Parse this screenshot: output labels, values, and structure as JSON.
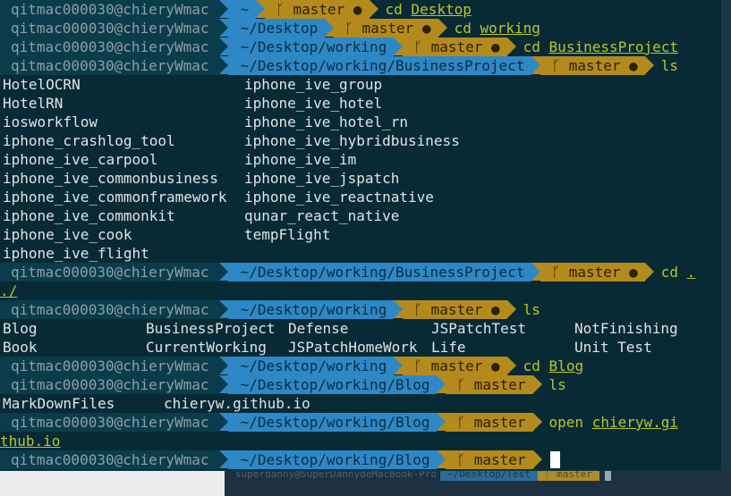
{
  "user": "qitmac000030@chieryWmac",
  "branch": "master",
  "background_window": {
    "prompt_user": "superdanny@SuperDannydeMacBook-Pro",
    "prompt_dir": "~/Desktop/Test",
    "prompt_branch": "master"
  },
  "prompts": [
    {
      "dir": "~",
      "dot": "●",
      "cmd": "cd",
      "arg": "Desktop"
    },
    {
      "dir": "~/Desktop",
      "dot": "●",
      "cmd": "cd",
      "arg": "working"
    },
    {
      "dir": "~/Desktop/working",
      "dot": "●",
      "cmd": "cd",
      "arg": "BusinessProject"
    },
    {
      "dir": "~/Desktop/working/BusinessProject",
      "dot": "●",
      "cmd": "ls",
      "arg": ""
    },
    {
      "dir": "~/Desktop/working/BusinessProject",
      "dot": "●",
      "cmd": "cd",
      "arg": "."
    },
    {
      "dir": "~/Desktop/working",
      "dot": "●",
      "cmd": "ls",
      "arg": ""
    },
    {
      "dir": "~/Desktop/working",
      "dot": "●",
      "cmd": "cd",
      "arg": "Blog"
    },
    {
      "dir": "~/Desktop/working/Blog",
      "dot": "",
      "cmd": "ls",
      "arg": ""
    },
    {
      "dir": "~/Desktop/working/Blog",
      "dot": "",
      "cmd": "open",
      "arg": "chieryw.gi"
    },
    {
      "dir": "~/Desktop/working/Blog",
      "dot": "",
      "cmd": "",
      "arg": ""
    }
  ],
  "wraps": {
    "cd_dot": "./",
    "open_arg": "thub.io"
  },
  "ls_business": [
    [
      "HotelOCRN",
      "iphone_ive_group"
    ],
    [
      "HotelRN",
      "iphone_ive_hotel"
    ],
    [
      "iosworkflow",
      "iphone_ive_hotel_rn"
    ],
    [
      "iphone_crashlog_tool",
      "iphone_ive_hybridbusiness"
    ],
    [
      "iphone_ive_carpool",
      "iphone_ive_im"
    ],
    [
      "iphone_ive_commonbusiness",
      "iphone_ive_jspatch"
    ],
    [
      "iphone_ive_commonframework",
      "iphone_ive_reactnative"
    ],
    [
      "iphone_ive_commonkit",
      "qunar_react_native"
    ],
    [
      "iphone_ive_cook",
      "tempFlight"
    ],
    [
      "iphone_ive_flight",
      ""
    ]
  ],
  "ls_working": [
    [
      "Blog",
      "BusinessProject",
      "Defense",
      "JSPatchTest",
      "NotFinishing"
    ],
    [
      "Book",
      "CurrentWorking",
      "JSPatchHomeWork",
      "Life",
      "Unit Test"
    ]
  ],
  "ls_blog": [
    "MarkDownFiles",
    "chieryw.github.io"
  ],
  "colors": {
    "background": "#082a35",
    "user_segment": "#0b3c4b",
    "dir_segment": "#2e88c6",
    "branch_segment": "#b58a1d",
    "command": "#b9c62f",
    "output_text": "#dfe5e6"
  },
  "icons": {
    "branch": "git-branch-icon",
    "separator": "powerline-arrow-icon"
  }
}
